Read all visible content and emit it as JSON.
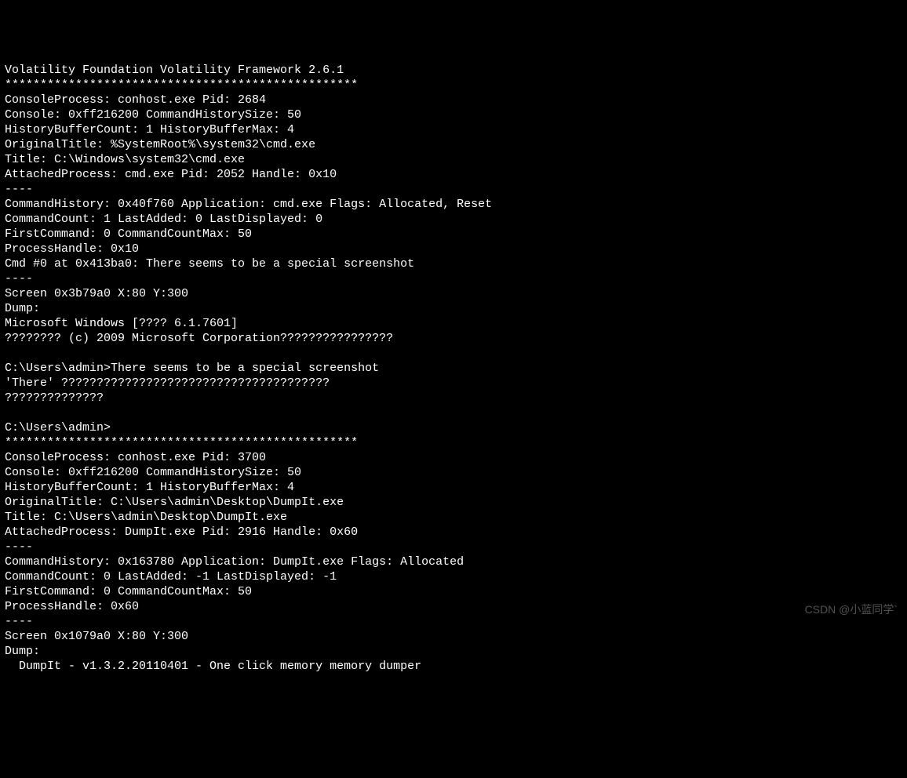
{
  "terminal": {
    "header": "Volatility Foundation Volatility Framework 2.6.1",
    "separator": "**************************************************",
    "block1": {
      "consoleProcess": "ConsoleProcess: conhost.exe Pid: 2684",
      "console": "Console: 0xff216200 CommandHistorySize: 50",
      "historyBuffer": "HistoryBufferCount: 1 HistoryBufferMax: 4",
      "originalTitle": "OriginalTitle: %SystemRoot%\\system32\\cmd.exe",
      "title": "Title: C:\\Windows\\system32\\cmd.exe",
      "attachedProcess": "AttachedProcess: cmd.exe Pid: 2052 Handle: 0x10",
      "dashes1": "----",
      "commandHistory": "CommandHistory: 0x40f760 Application: cmd.exe Flags: Allocated, Reset",
      "commandCount": "CommandCount: 1 LastAdded: 0 LastDisplayed: 0",
      "firstCommand": "FirstCommand: 0 CommandCountMax: 50",
      "processHandle": "ProcessHandle: 0x10",
      "cmd0": "Cmd #0 at 0x413ba0: There seems to be a special screenshot",
      "dashes2": "----",
      "screen": "Screen 0x3b79a0 X:80 Y:300",
      "dump": "Dump:",
      "msWindows": "Microsoft Windows [???? 6.1.7601]",
      "copyright": "???????? (c) 2009 Microsoft Corporation????????????????",
      "blank1": "",
      "prompt1": "C:\\Users\\admin>There seems to be a special screenshot",
      "there": "'There' ??????????????????????????????????????",
      "qmarks": "??????????????",
      "blank2": "",
      "prompt2": "C:\\Users\\admin>"
    },
    "block2": {
      "consoleProcess": "ConsoleProcess: conhost.exe Pid: 3700",
      "console": "Console: 0xff216200 CommandHistorySize: 50",
      "historyBuffer": "HistoryBufferCount: 1 HistoryBufferMax: 4",
      "originalTitle": "OriginalTitle: C:\\Users\\admin\\Desktop\\DumpIt.exe",
      "title": "Title: C:\\Users\\admin\\Desktop\\DumpIt.exe",
      "attachedProcess": "AttachedProcess: DumpIt.exe Pid: 2916 Handle: 0x60",
      "dashes1": "----",
      "commandHistory": "CommandHistory: 0x163780 Application: DumpIt.exe Flags: Allocated",
      "commandCount": "CommandCount: 0 LastAdded: -1 LastDisplayed: -1",
      "firstCommand": "FirstCommand: 0 CommandCountMax: 50",
      "processHandle": "ProcessHandle: 0x60",
      "dashes2": "----",
      "screen": "Screen 0x1079a0 X:80 Y:300",
      "dump": "Dump:",
      "dumpit": "  DumpIt - v1.3.2.20110401 - One click memory memory dumper"
    }
  },
  "watermark": "CSDN @小蓝同学`"
}
